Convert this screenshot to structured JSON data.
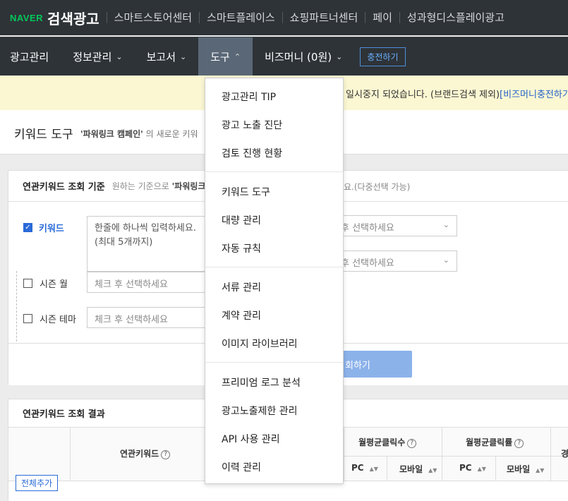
{
  "brand": {
    "naver": "NAVER",
    "title": "검색광고"
  },
  "top_links": [
    "스마트스토어센터",
    "스마트플레이스",
    "쇼핑파트너센터",
    "페이",
    "성과형디스플레이광고"
  ],
  "nav": {
    "items": [
      "광고관리",
      "정보관리",
      "보고서",
      "도구",
      "비즈머니 (0원)"
    ],
    "charge_button": "충전하기"
  },
  "notice": {
    "text": "일시중지 되었습니다. (브랜드검색 제외)",
    "link": "[비즈머니충전하기]"
  },
  "page": {
    "title": "키워드 도구",
    "sub_bold": "'파워링크 캠페인'",
    "sub_rest": "의 새로운 키워"
  },
  "criteria": {
    "heading": "연관키워드 조회 기준",
    "desc_prefix": "원하는 기준으로 ",
    "desc_bold": "'파워링크",
    "hint": "요.(다중선택 가능)",
    "keyword_label": "키워드",
    "keyword_placeholder_1": "한줄에 하나씩 입력하세요.",
    "keyword_placeholder_2": "(최대 5개까지)",
    "select_right_1": "후 선택하세요",
    "select_right_2": "후 선택하세요",
    "season_month_label": "시즌 월",
    "season_month_select": "체크 후 선택하세요",
    "season_theme_label": "시즌 테마",
    "season_theme_select": "체크 후 선택하세요",
    "keyword_checked": true,
    "search_button": "회하기"
  },
  "results": {
    "heading": "연관키워드 조회 결과",
    "add_all": "전체추가",
    "col_keyword": "연관키워드",
    "col_clicks": "월평균클릭수",
    "col_ctr": "월평균클릭률",
    "col_edge": "경",
    "sub_pc_1": "PC",
    "sub_mobile_1": "모바일",
    "sub_pc_2": "PC",
    "sub_mobile_2": "모바일"
  },
  "tools_menu": {
    "groups": [
      [
        "광고관리 TIP",
        "광고 노출 진단",
        "검토 진행 현황"
      ],
      [
        "키워드 도구",
        "대량 관리",
        "자동 규칙"
      ],
      [
        "서류 관리",
        "계약 관리",
        "이미지 라이브러리"
      ],
      [
        "프리미엄 로그 분석",
        "광고노출제한 관리",
        "API 사용 관리",
        "이력 관리"
      ]
    ]
  },
  "colors": {
    "topbar": "#2e3338",
    "active_nav": "#5a6776",
    "naver_green": "#03c75a",
    "link_blue": "#2663c9",
    "notice_bg": "#fbf7d2"
  }
}
